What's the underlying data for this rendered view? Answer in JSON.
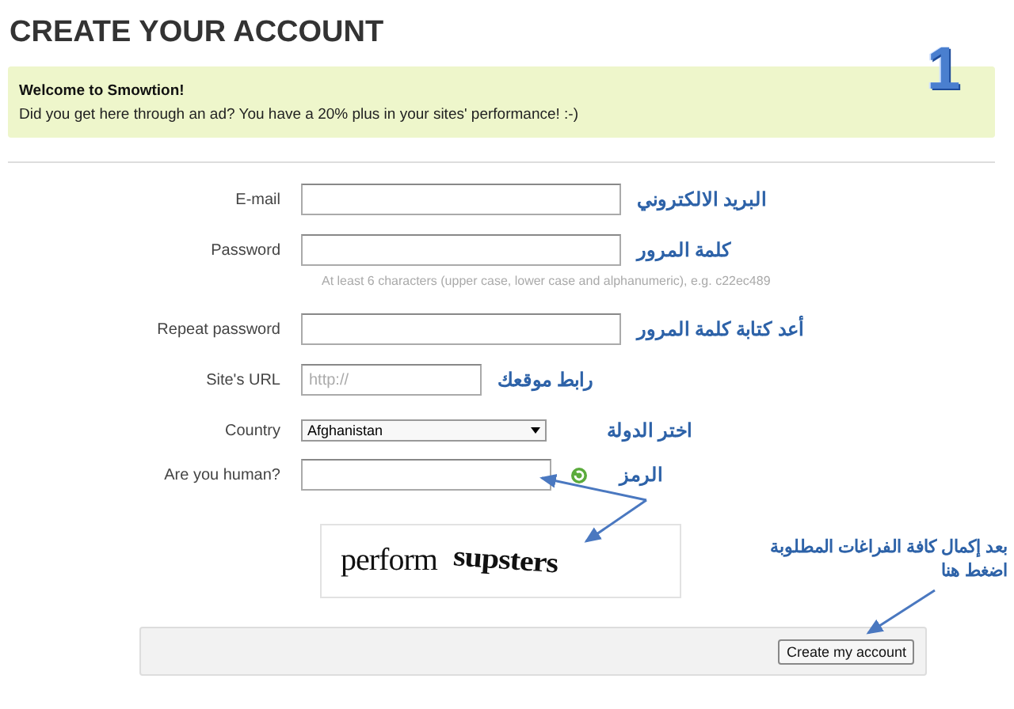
{
  "page": {
    "title": "CREATE YOUR ACCOUNT",
    "badge": "1"
  },
  "notice": {
    "title": "Welcome to Smowtion!",
    "message": "Did you get here through an ad? You have a 20% plus in your sites' performance! :-)"
  },
  "fields": [
    {
      "kind": "text",
      "label": "E-mail",
      "annotation": "البريد الالكتروني"
    },
    {
      "kind": "password",
      "label": "Password",
      "annotation": "كلمة المرور",
      "hint": "At least 6 characters (upper case, lower case and alphanumeric), e.g. c22ec489"
    },
    {
      "kind": "password",
      "label": "Repeat password",
      "annotation": "أعد كتابة كلمة المرور"
    },
    {
      "kind": "url",
      "label": "Site's URL",
      "placeholder": "http://",
      "annotation": "رابط موقعك"
    },
    {
      "kind": "select",
      "label": "Country",
      "value": "Afghanistan",
      "annotation": "اختر الدولة"
    },
    {
      "kind": "captcha",
      "label": "Are you human?",
      "annotation": "الرمز"
    }
  ],
  "captcha": {
    "words": [
      "perform",
      "supsters"
    ]
  },
  "submit": {
    "label": "Create my account",
    "annotation": "بعد إكمال كافة الفراغات المطلوبة اضغط هنا"
  }
}
